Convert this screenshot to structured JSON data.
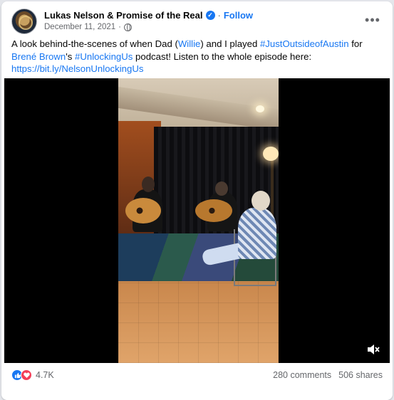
{
  "post": {
    "author": "Lukas Nelson & Promise of the Real",
    "separator": "·",
    "follow_label": "Follow",
    "date": "December 11, 2021",
    "date_sep": "·",
    "more_label": "•••",
    "text": {
      "p1": "A look behind-the-scenes of when Dad (",
      "mention": "Willie",
      "p2": ") and I played ",
      "hashtag1": "#JustOutsideofAustin",
      "p3": " for ",
      "mention2": "Brené Brown",
      "p4": "'s ",
      "hashtag2": "#UnlockingUs",
      "p5": " podcast! Listen to the whole episode here: ",
      "url": "https://bit.ly/NelsonUnlockingUs"
    }
  },
  "video": {
    "mute_icon": "speaker-muted-icon"
  },
  "stats": {
    "reactions_count": "4.7K",
    "comments": "280 comments",
    "shares": "506 shares"
  },
  "colors": {
    "link": "#1877f2",
    "like": "#1877f2",
    "love": "#f33e58",
    "muted_text": "#65676b"
  }
}
